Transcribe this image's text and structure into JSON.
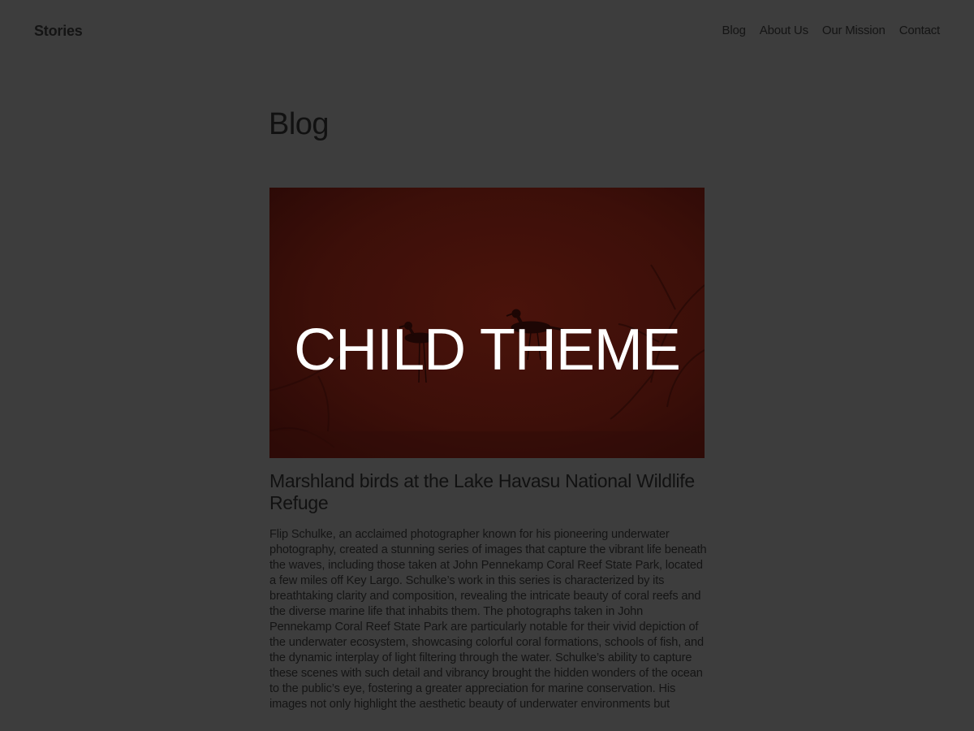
{
  "header": {
    "site_title": "Stories",
    "nav": [
      "Blog",
      "About Us",
      "Our Mission",
      "Contact"
    ]
  },
  "main": {
    "page_title": "Blog",
    "post": {
      "image_overlay_text": "CHILD THEME",
      "title": "Marshland birds at the Lake Havasu National Wildlife Refuge",
      "excerpt": "Flip Schulke, an acclaimed photographer known for his pioneering underwater photography, created a stunning series of images that capture the vibrant life beneath the waves, including those taken at John Pennekamp Coral Reef State Park, located a few miles off Key Largo. Schulke’s work in this series is characterized by its breathtaking clarity and composition, revealing the intricate beauty of coral reefs and the diverse marine life that inhabits them. The photographs taken in John Pennekamp Coral Reef State Park are particularly notable for their vivid depiction of the underwater ecosystem, showcasing colorful coral formations, schools of fish, and the dynamic interplay of light filtering through the water. Schulke’s ability to capture these scenes with such detail and vibrancy brought the hidden wonders of the ocean to the public’s eye, fostering a greater appreciation for marine conservation. His images not only highlight the aesthetic beauty of underwater environments but"
    }
  },
  "colors": {
    "background": "#3d3d3d",
    "text": "#141414",
    "image_tint": "#3a0f0a",
    "overlay_text": "#ffffff"
  }
}
